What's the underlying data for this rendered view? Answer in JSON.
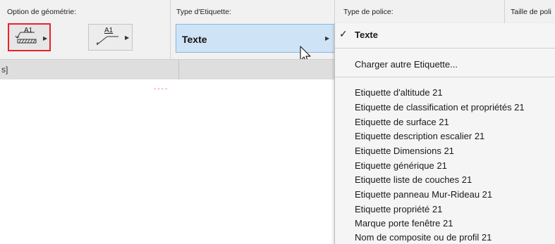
{
  "infobox": {
    "geometry_label": "Option de géométrie:",
    "label_type_label": "Type d'Etiquette:",
    "font_type_label": "Type de police:",
    "font_size_label": "Taille de poli",
    "geo_option_1_text": "A1",
    "geo_option_2_text": "A1",
    "label_type_value": "Texte"
  },
  "dimension_bar": {
    "text": "s]"
  },
  "menu": {
    "checked_item": "Texte",
    "load_other": "Charger autre Etiquette...",
    "items": [
      "Etiquette d'altitude 21",
      "Etiquette de classification et propriétés 21",
      "Etiquette de surface 21",
      "Etiquette description escalier 21",
      "Etiquette Dimensions 21",
      "Etiquette générique 21",
      "Etiquette liste de couches 21",
      "Etiquette panneau Mur-Rideau 21",
      "Etiquette propriété 21",
      "Marque porte fenêtre 21",
      "Nom de composite ou de profil 21"
    ]
  },
  "colors": {
    "selected_border": "#e8232a",
    "dropdown_highlight": "#cfe3f6",
    "accent_dashes": "#f2a98a"
  }
}
